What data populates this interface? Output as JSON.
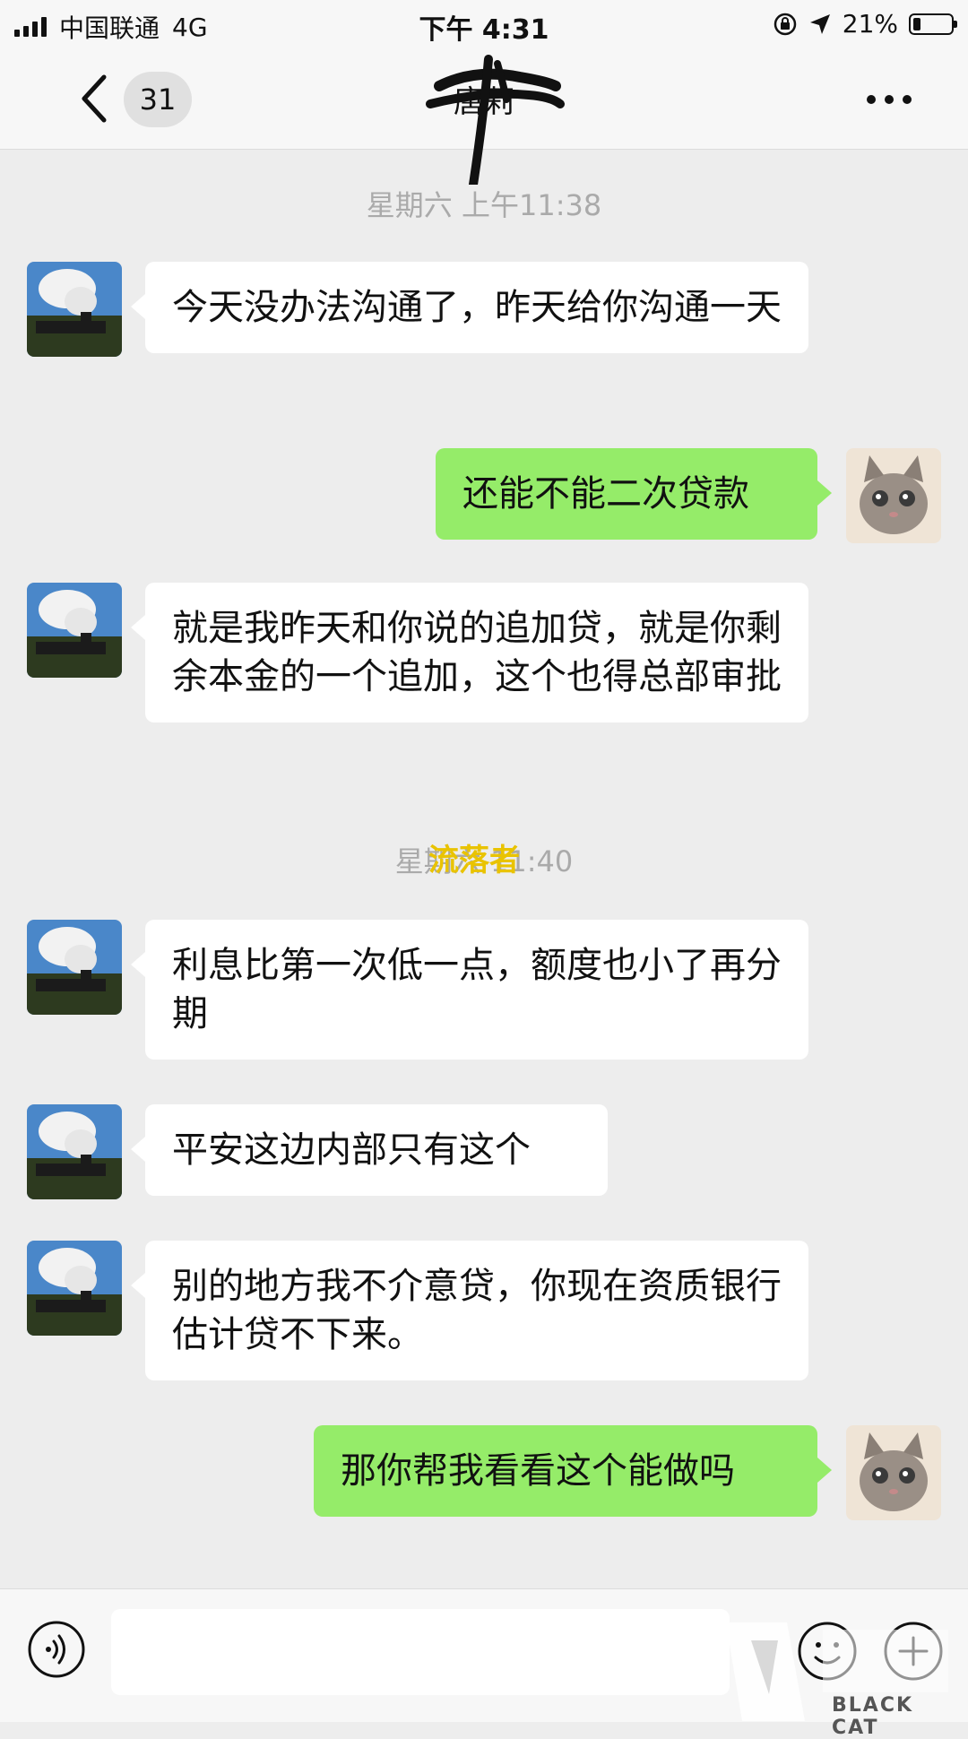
{
  "status_bar": {
    "carrier": "中国联通",
    "network": "4G",
    "time": "下午 4:31",
    "battery_percent": "21%",
    "battery_level": 0.21
  },
  "nav": {
    "unread_count": "31",
    "title": "唐莉"
  },
  "timestamps": {
    "t1": "星期六 上午11:38",
    "t2_prefix": "星期六 ",
    "t2_suffix": "11:40",
    "t2_overlay": "流落者"
  },
  "messages": [
    {
      "side": "in",
      "text": "今天没办法沟通了，昨天给你沟通一天"
    },
    {
      "side": "out",
      "text": "还能不能二次贷款"
    },
    {
      "side": "in",
      "text": "就是我昨天和你说的追加贷，就是你剩余本金的一个追加，这个也得总部审批"
    },
    {
      "side": "in",
      "text": "利息比第一次低一点，额度也小了再分期"
    },
    {
      "side": "in",
      "text": "平安这边内部只有这个"
    },
    {
      "side": "in",
      "text": "别的地方我不介意贷，你现在资质银行估计贷不下来。"
    },
    {
      "side": "out",
      "text": "那你帮我看看这个能做吗"
    }
  ],
  "input_bar": {
    "placeholder": ""
  },
  "watermark": {
    "label": "BLACK CAT"
  },
  "colors": {
    "background": "#ededed",
    "outgoing_bubble": "#95ec69",
    "incoming_bubble": "#ffffff",
    "timestamp": "#aaaaaa"
  }
}
